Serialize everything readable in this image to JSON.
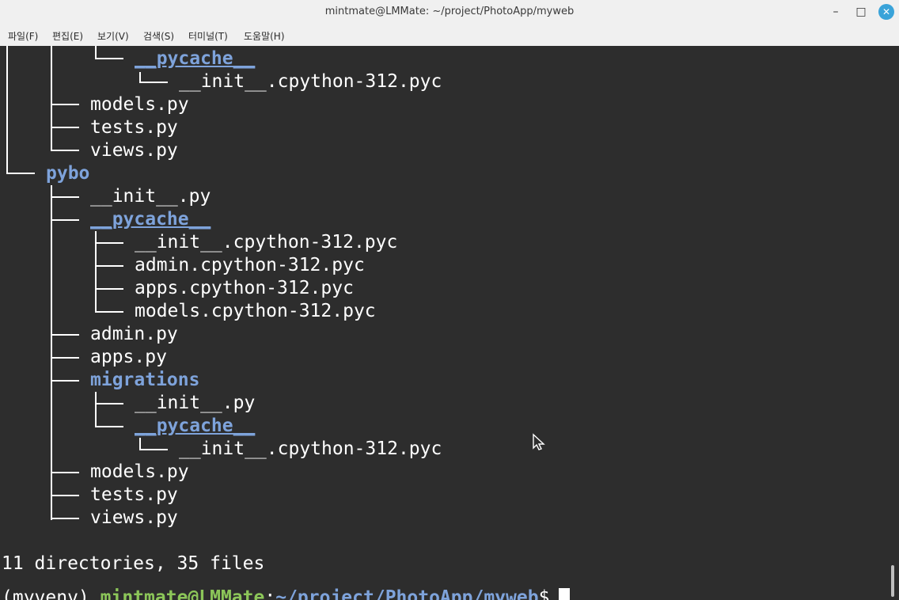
{
  "window": {
    "title": "mintmate@LMMate: ~/project/PhotoApp/myweb",
    "minimize": "–",
    "maximize": "□",
    "close": "✕"
  },
  "menu": [
    "파일(F)",
    "편집(E)",
    "보기(V)",
    "검색(S)",
    "터미널(T)",
    "도움말(H)"
  ],
  "tree": [
    {
      "name": "__pycache__",
      "type": "cache"
    },
    {
      "name": "__init__.cpython-312.pyc",
      "type": "file"
    },
    {
      "name": "models.py",
      "type": "file"
    },
    {
      "name": "tests.py",
      "type": "file"
    },
    {
      "name": "views.py",
      "type": "file"
    },
    {
      "name": "pybo",
      "type": "dir"
    },
    {
      "name": "__init__.py",
      "type": "file"
    },
    {
      "name": "__pycache__",
      "type": "cache"
    },
    {
      "name": "__init__.cpython-312.pyc",
      "type": "file"
    },
    {
      "name": "admin.cpython-312.pyc",
      "type": "file"
    },
    {
      "name": "apps.cpython-312.pyc",
      "type": "file"
    },
    {
      "name": "models.cpython-312.pyc",
      "type": "file"
    },
    {
      "name": "admin.py",
      "type": "file"
    },
    {
      "name": "apps.py",
      "type": "file"
    },
    {
      "name": "migrations",
      "type": "dir"
    },
    {
      "name": "__init__.py",
      "type": "file"
    },
    {
      "name": "__pycache__",
      "type": "cache"
    },
    {
      "name": "__init__.cpython-312.pyc",
      "type": "file"
    },
    {
      "name": "models.py",
      "type": "file"
    },
    {
      "name": "tests.py",
      "type": "file"
    },
    {
      "name": "views.py",
      "type": "file"
    }
  ],
  "summary": "11 directories, 35 files",
  "prompt": {
    "venv": "(myvenv)",
    "user_host": "mintmate@LMMate",
    "colon": ":",
    "path": "~/project/PhotoApp/myweb",
    "symbol": "$"
  },
  "colors": {
    "terminal_bg": "#2d2d2d",
    "directory": "#7ea3db",
    "user_host": "#8cc659",
    "close_button": "#3aa3d9"
  }
}
